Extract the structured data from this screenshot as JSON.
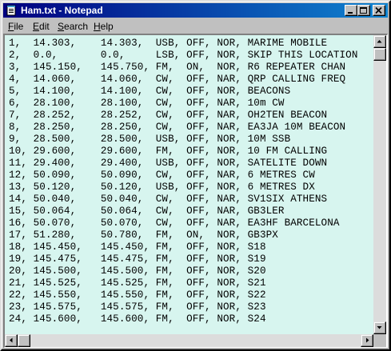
{
  "window": {
    "title": "Ham.txt - Notepad",
    "icon": "notepad-icon"
  },
  "menu": {
    "items": [
      {
        "label": "File",
        "mnemonic": "F",
        "rest": "ile"
      },
      {
        "label": "Edit",
        "mnemonic": "E",
        "rest": "dit"
      },
      {
        "label": "Search",
        "mnemonic": "S",
        "rest": "earch"
      },
      {
        "label": "Help",
        "mnemonic": "H",
        "rest": "elp"
      }
    ]
  },
  "document": {
    "lines": [
      "1,  14.303,    14.303,  USB, OFF, NOR, MARIME MOBILE",
      "2,  0.0,       0.0,     LSB, OFF, NOR, SKIP THIS LOCATION",
      "3,  145.150,   145.750, FM,  ON,  NOR, R6 REPEATER CHAN",
      "4,  14.060,    14.060,  CW,  OFF, NAR, QRP CALLING FREQ",
      "5,  14.100,    14.100,  CW,  OFF, NOR, BEACONS",
      "6,  28.100,    28.100,  CW,  OFF, NAR, 10m CW",
      "7,  28.252,    28.252,  CW,  OFF, NAR, OH2TEN BEACON",
      "8,  28.250,    28.250,  CW,  OFF, NAR, EA3JA 10M BEACON",
      "9,  28.500,    28.500,  USB, OFF, NOR, 10M SSB",
      "10, 29.600,    29.600,  FM,  OFF, NOR, 10 FM CALLING",
      "11, 29.400,    29.400,  USB, OFF, NOR, SATELITE DOWN",
      "12, 50.090,    50.090,  CW,  OFF, NAR, 6 METRES CW",
      "13, 50.120,    50.120,  USB, OFF, NOR, 6 METRES DX",
      "14, 50.040,    50.040,  CW,  OFF, NAR, SV1SIX ATHENS",
      "15, 50.064,    50.064,  CW,  OFF, NAR, GB3LER",
      "16, 50.070,    50.070,  CW,  OFF, NAR, EA3HF BARCELONA",
      "17, 51.280,    50.780,  FM,  ON,  NOR, GB3PX",
      "18, 145.450,   145.450, FM,  OFF, NOR, S18",
      "19, 145.475,   145.475, FM,  OFF, NOR, S19",
      "20, 145.500,   145.500, FM,  OFF, NOR, S20",
      "21, 145.525,   145.525, FM,  OFF, NOR, S21",
      "22, 145.550,   145.550, FM,  OFF, NOR, S22",
      "23, 145.575,   145.575, FM,  OFF, NOR, S23",
      "24, 145.600,   145.600, FM,  OFF, NOR, S24"
    ]
  },
  "colors": {
    "title_bar_start": "#000080",
    "title_bar_end": "#1084d0",
    "text_background": "#d7f5ef",
    "window_face": "#c0c0c0"
  },
  "icons": {
    "minimize": "minimize-icon",
    "maximize": "maximize-icon",
    "close": "close-icon",
    "scroll_up": "arrow-up-icon",
    "scroll_down": "arrow-down-icon",
    "scroll_left": "arrow-left-icon",
    "scroll_right": "arrow-right-icon"
  }
}
